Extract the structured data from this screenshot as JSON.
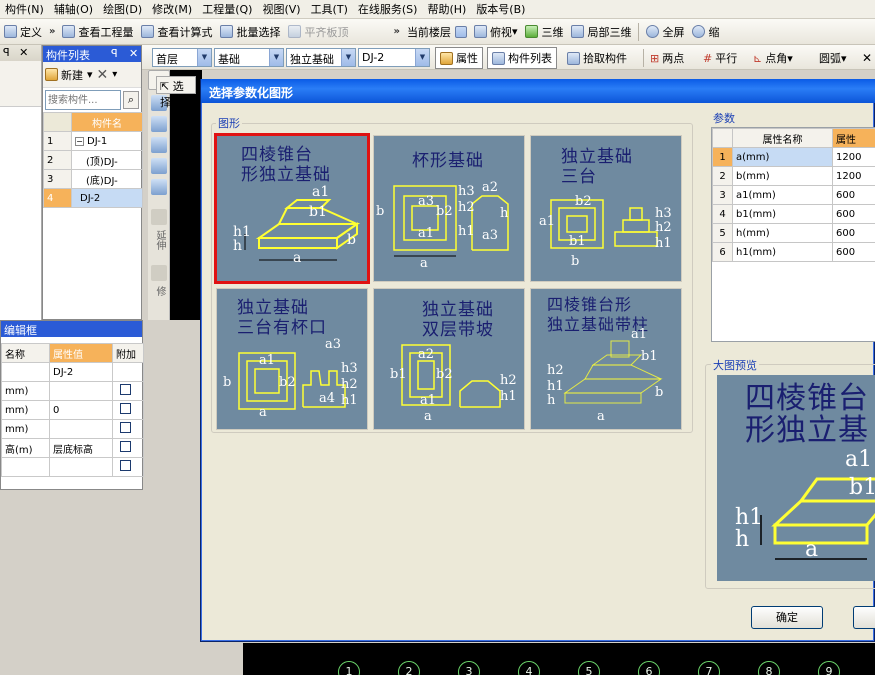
{
  "menu": [
    "构件(N)",
    "辅轴(O)",
    "绘图(D)",
    "修改(M)",
    "工程量(Q)",
    "视图(V)",
    "工具(T)",
    "在线服务(S)",
    "帮助(H)",
    "版本号(B)"
  ],
  "toolbar": {
    "define": "定义",
    "view_quantity": "查看工程量",
    "view_formula": "查看计算式",
    "batch_select": "批量选择",
    "align_slab": "平齐板顶",
    "current_floor": "当前楼层",
    "top_view": "俯视",
    "three_d": "三维",
    "local_3d": "局部三维",
    "fullscreen": "全屏",
    "zoom": "缩"
  },
  "toolbar2": {
    "floor": "首层",
    "type": "基础",
    "subtype": "独立基础",
    "member": "DJ-2",
    "attributes": "属性",
    "member_list": "构件列表",
    "pick": "拾取构件",
    "two_points": "两点",
    "parallel": "平行",
    "point_angle": "点角",
    "arc": "圆弧",
    "select": "选择"
  },
  "component_panel": {
    "title": "构件列表",
    "new_button": "新建",
    "search_placeholder": "搜索构件...",
    "col_header": "构件名",
    "rows": [
      {
        "num": "1",
        "name": "DJ-1"
      },
      {
        "num": "2",
        "name": "(顶)DJ-"
      },
      {
        "num": "3",
        "name": "(底)DJ-"
      },
      {
        "num": "4",
        "name": "DJ-2"
      }
    ]
  },
  "prop_panel": {
    "title": "编辑框",
    "headers": [
      "名称",
      "属性值",
      "附加"
    ],
    "rows": [
      {
        "name": "",
        "value": "DJ-2"
      },
      {
        "name": "mm)",
        "value": ""
      },
      {
        "name": "mm)",
        "value": "0"
      },
      {
        "name": "mm)",
        "value": ""
      },
      {
        "name": "高(m)",
        "value": "层底标高"
      },
      {
        "name": "",
        "value": ""
      }
    ]
  },
  "side_tools": [
    "延伸",
    "修"
  ],
  "dialog": {
    "title": "选择参数化图形",
    "shapes_group": "图形",
    "params_group": "参数",
    "preview_group": "大图预览",
    "ok": "确定",
    "shapes": [
      {
        "t1": "四棱锥台",
        "t2": "形独立基础"
      },
      {
        "t1": "杯形基础",
        "t2": ""
      },
      {
        "t1": "独立基础",
        "t2": "三台"
      },
      {
        "t1": "独立基础",
        "t2": "三台有杯口"
      },
      {
        "t1": "独立基础",
        "t2": "双层带坡"
      },
      {
        "t1": "四棱锥台形",
        "t2": "独立基础带柱"
      }
    ],
    "params": {
      "headers": [
        "属性名称",
        "属性"
      ],
      "rows": [
        {
          "n": "1",
          "name": "a(mm)",
          "v": "1200"
        },
        {
          "n": "2",
          "name": "b(mm)",
          "v": "1200"
        },
        {
          "n": "3",
          "name": "a1(mm)",
          "v": "600"
        },
        {
          "n": "4",
          "name": "b1(mm)",
          "v": "600"
        },
        {
          "n": "5",
          "name": "h(mm)",
          "v": "600"
        },
        {
          "n": "6",
          "name": "h1(mm)",
          "v": "600"
        }
      ]
    },
    "preview": {
      "t1": "四棱锥台",
      "t2": "形独立基"
    },
    "dim_labels": {
      "a": "a",
      "b": "b",
      "a1": "a1",
      "b1": "b1",
      "h": "h",
      "h1": "h1",
      "h2": "h2",
      "h3": "h3",
      "a2": "a2",
      "a3": "a3",
      "a4": "a4",
      "b2": "b2",
      "b3": "b3"
    }
  },
  "axes": [
    "1",
    "2",
    "3",
    "4",
    "5",
    "6",
    "7",
    "8",
    "9"
  ]
}
